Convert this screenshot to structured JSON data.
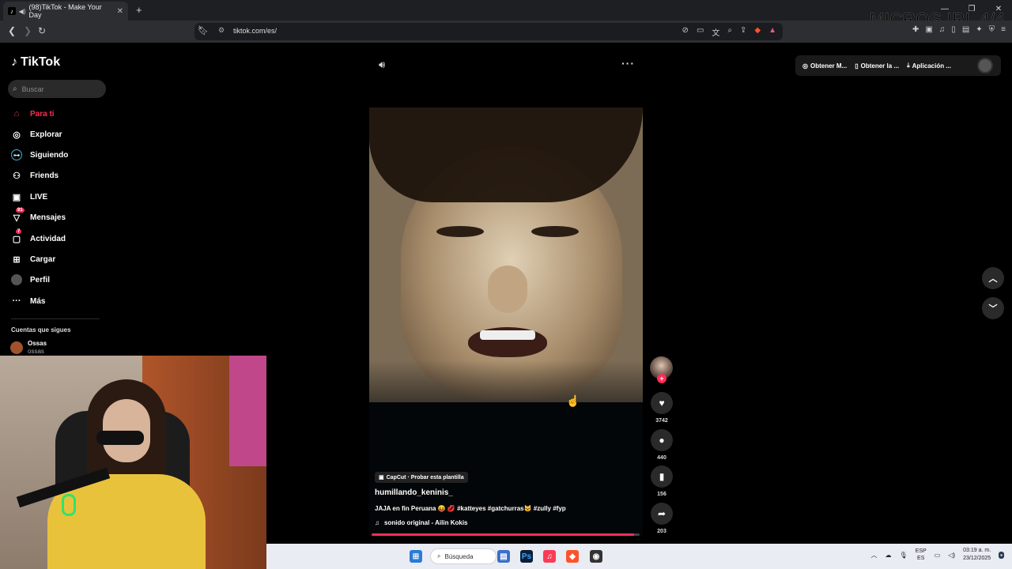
{
  "browser": {
    "tab_title": "(98)TikTok - Make Your Day",
    "url": "tiktok.com/es/",
    "overlay_text": "MICROS IRL 4/4"
  },
  "sidebar": {
    "logo": "TikTok",
    "search_placeholder": "Buscar",
    "items": [
      {
        "label": "Para ti",
        "icon": "home-icon",
        "active": true
      },
      {
        "label": "Explorar",
        "icon": "compass-icon"
      },
      {
        "label": "Siguiendo",
        "icon": "following-icon"
      },
      {
        "label": "Friends",
        "icon": "friends-icon"
      },
      {
        "label": "LIVE",
        "icon": "live-icon"
      },
      {
        "label": "Mensajes",
        "icon": "messages-icon",
        "badge": "91"
      },
      {
        "label": "Actividad",
        "icon": "activity-icon",
        "badge": "7"
      },
      {
        "label": "Cargar",
        "icon": "upload-icon"
      },
      {
        "label": "Perfil",
        "icon": "profile-icon"
      },
      {
        "label": "Más",
        "icon": "more-icon"
      }
    ],
    "following_title": "Cuentas que sigues",
    "following_account": {
      "name": "Ossas",
      "handle": "ossas"
    }
  },
  "topbar": {
    "btn1": "Obtener M...",
    "btn2": "Obtener la ...",
    "btn3": "Aplicación ..."
  },
  "video": {
    "capcut_label": "CapCut · Probar esta plantilla",
    "author": "humillando_keninis_",
    "caption": "JAJA en fin Peruana 😝 💋 #katteyes #gatchurras🐱 #zully #fyp",
    "sound": "sonido original - Ailin Kokis",
    "likes": "3742",
    "comments": "440",
    "saves": "156",
    "shares": "203",
    "progress": 0.98
  },
  "taskbar": {
    "search_label": "Búsqueda",
    "lang_top": "ESP",
    "lang_bottom": "ES",
    "time": "03:19 a. m.",
    "date": "23/12/2025"
  },
  "colors": {
    "accent": "#fe2c55",
    "background": "#000000"
  }
}
